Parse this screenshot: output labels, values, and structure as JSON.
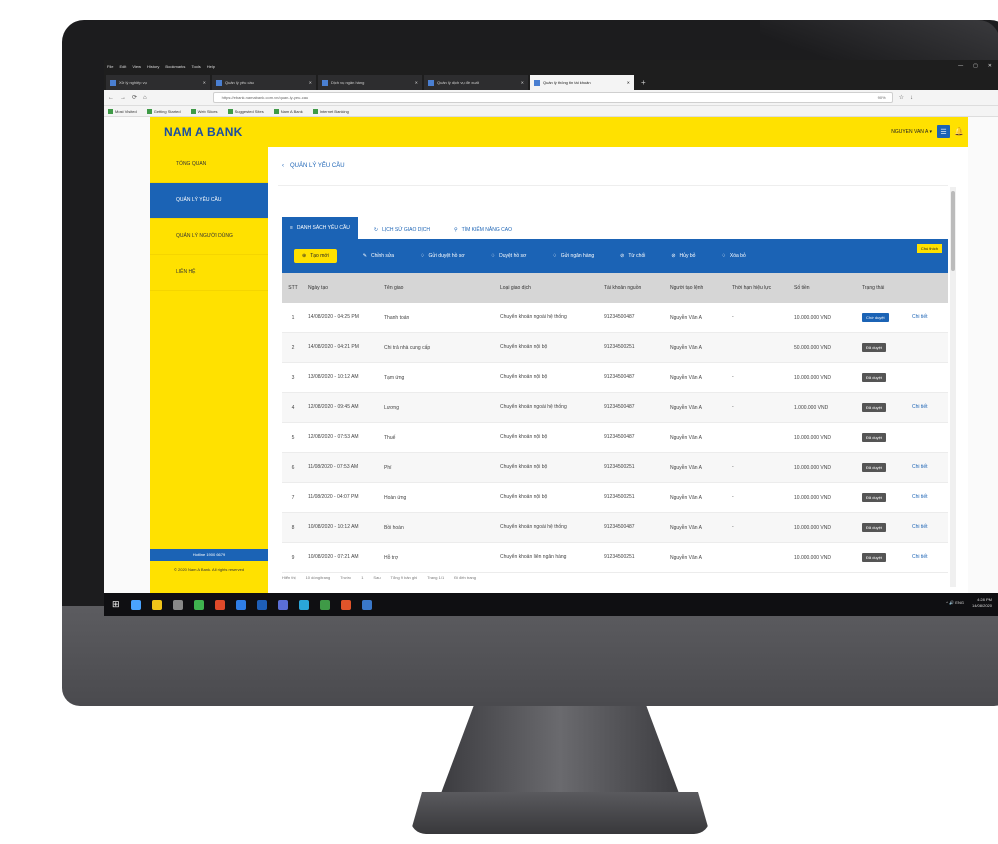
{
  "browser": {
    "menu": [
      "File",
      "Edit",
      "View",
      "History",
      "Bookmarks",
      "Tools",
      "Help"
    ],
    "window_controls": [
      "—",
      "▢",
      "✕"
    ],
    "tabs": [
      {
        "label": "Xử lý nghiệp vụ",
        "active": false
      },
      {
        "label": "Quản lý yêu cầu",
        "active": false
      },
      {
        "label": "Dịch vụ ngân hàng",
        "active": false
      },
      {
        "label": "Quản lý dịch vụ đề xuất",
        "active": false
      },
      {
        "label": "Quản lý thông tin tài khoản",
        "active": true
      }
    ],
    "new_tab": "+",
    "url": "https://ebank.namabank.com.vn/quan-ly-yeu-cau",
    "zoom": "90%",
    "bookmarks": [
      "Most Visited",
      "Getting Started",
      "Web Slices",
      "Suggested Sites",
      "Nam A Bank",
      "Internet Banking"
    ]
  },
  "app": {
    "logo": "NAM A BANK",
    "user": "NGUYEN VAN A",
    "menu_glyph": "☰",
    "bell_glyph": "🔔",
    "sidebar": [
      {
        "label": "TỔNG QUAN",
        "active": false
      },
      {
        "label": "QUẢN LÝ YÊU CẦU",
        "active": true
      },
      {
        "label": "QUẢN LÝ NGƯỜI DÙNG",
        "active": false
      },
      {
        "label": "LIÊN HỆ",
        "active": false
      }
    ],
    "hotline": "Hotline 1900 6679",
    "footer": "© 2020 Nam A Bank. All rights reserved"
  },
  "main": {
    "back_label": "QUẢN LÝ YÊU CẦU",
    "tabs": [
      {
        "label": "DANH SÁCH YÊU CẦU",
        "active": true
      },
      {
        "label": "LỊCH SỬ GIAO DỊCH",
        "active": false
      },
      {
        "label": "TÌM KIẾM NÂNG CAO",
        "active": false
      }
    ],
    "toolbar": [
      {
        "label": "Tạo mới",
        "primary": true
      },
      {
        "label": "Chỉnh sửa",
        "primary": false
      },
      {
        "label": "Gửi duyệt hồ sơ",
        "primary": false
      },
      {
        "label": "Duyệt hồ sơ",
        "primary": false
      },
      {
        "label": "Gửi ngân hàng",
        "primary": false
      },
      {
        "label": "Từ chối",
        "primary": false
      },
      {
        "label": "Hủy bỏ",
        "primary": false
      },
      {
        "label": "Xóa bỏ",
        "primary": false
      }
    ],
    "legend": "Chú thích",
    "columns": [
      "STT",
      "Ngày tạo",
      "Tên giao",
      "Loại giao dịch",
      "Tài khoản nguồn",
      "Người tạo lệnh",
      "Thời hạn hiệu lực",
      "Số tiền",
      "Trạng thái",
      ""
    ],
    "rows": [
      {
        "stt": "1",
        "date": "14/08/2020 - 04:25 PM",
        "name": "Thanh toán",
        "type": "Chuyển khoản ngoài hệ thống",
        "account": "91234500487",
        "creator": "Nguyễn Văn A",
        "expiry": "-",
        "amount": "10.000.000 VND",
        "status": "Chờ duyệt",
        "status_blue": true,
        "action": "Chi tiết"
      },
      {
        "stt": "2",
        "date": "14/08/2020 - 04:21 PM",
        "name": "Chi trả nhà cung cấp",
        "type": "Chuyển khoản nội bộ",
        "account": "91234500251",
        "creator": "Nguyễn Văn A",
        "expiry": "",
        "amount": "50.000.000 VND",
        "status": "Đã duyệt",
        "status_blue": false,
        "action": ""
      },
      {
        "stt": "3",
        "date": "13/08/2020 - 10:12 AM",
        "name": "Tạm ứng",
        "type": "Chuyển khoản nội bộ",
        "account": "91234500487",
        "creator": "Nguyễn Văn A",
        "expiry": "-",
        "amount": "10.000.000 VND",
        "status": "Đã duyệt",
        "status_blue": false,
        "action": ""
      },
      {
        "stt": "4",
        "date": "12/08/2020 - 09:45 AM",
        "name": "Lương",
        "type": "Chuyển khoản ngoài hệ thống",
        "account": "91234500487",
        "creator": "Nguyễn Văn A",
        "expiry": "-",
        "amount": "1.000.000 VND",
        "status": "Đã duyệt",
        "status_blue": false,
        "action": "Chi tiết"
      },
      {
        "stt": "5",
        "date": "12/08/2020 - 07:53 AM",
        "name": "Thuế",
        "type": "Chuyển khoản nội bộ",
        "account": "91234500487",
        "creator": "Nguyễn Văn A",
        "expiry": "",
        "amount": "10.000.000 VND",
        "status": "Đã duyệt",
        "status_blue": false,
        "action": ""
      },
      {
        "stt": "6",
        "date": "11/08/2020 - 07:53 AM",
        "name": "Phí",
        "type": "Chuyển khoản nội bộ",
        "account": "91234500251",
        "creator": "Nguyễn Văn A",
        "expiry": "-",
        "amount": "10.000.000 VND",
        "status": "Đã duyệt",
        "status_blue": false,
        "action": "Chi tiết"
      },
      {
        "stt": "7",
        "date": "11/08/2020 - 04:07 PM",
        "name": "Hoàn ứng",
        "type": "Chuyển khoản nội bộ",
        "account": "91234500251",
        "creator": "Nguyễn Văn A",
        "expiry": "-",
        "amount": "10.000.000 VND",
        "status": "Đã duyệt",
        "status_blue": false,
        "action": "Chi tiết"
      },
      {
        "stt": "8",
        "date": "10/08/2020 - 10:12 AM",
        "name": "Bồi hoàn",
        "type": "Chuyển khoản ngoài hệ thống",
        "account": "91234500487",
        "creator": "Nguyễn Văn A",
        "expiry": "-",
        "amount": "10.000.000 VND",
        "status": "Đã duyệt",
        "status_blue": false,
        "action": "Chi tiết"
      },
      {
        "stt": "9",
        "date": "10/08/2020 - 07:21 AM",
        "name": "Hỗ trợ",
        "type": "Chuyển khoản liên ngân hàng",
        "account": "91234500251",
        "creator": "Nguyễn Văn A",
        "expiry": "",
        "amount": "10.000.000 VND",
        "status": "Đã duyệt",
        "status_blue": false,
        "action": "Chi tiết"
      }
    ],
    "pager": [
      "Hiển thị",
      "10 dòng/trang",
      "Trước",
      "1",
      "Sau",
      "Tổng 9 bản ghi",
      "Trang 1/1",
      "Đi đến trang"
    ]
  },
  "taskbar": {
    "icon_colors": [
      "#4aa3ff",
      "#f0c419",
      "#888888",
      "#3fb34f",
      "#e04a2a",
      "#2f7ee6",
      "#1e5fb8",
      "#5b6fd6",
      "#2aa6d9",
      "#3f9a47",
      "#e0542a",
      "#3a78c9"
    ],
    "tray_text": "^ 🔊 ENG",
    "time": "4:28 PM",
    "date": "14/08/2020"
  }
}
